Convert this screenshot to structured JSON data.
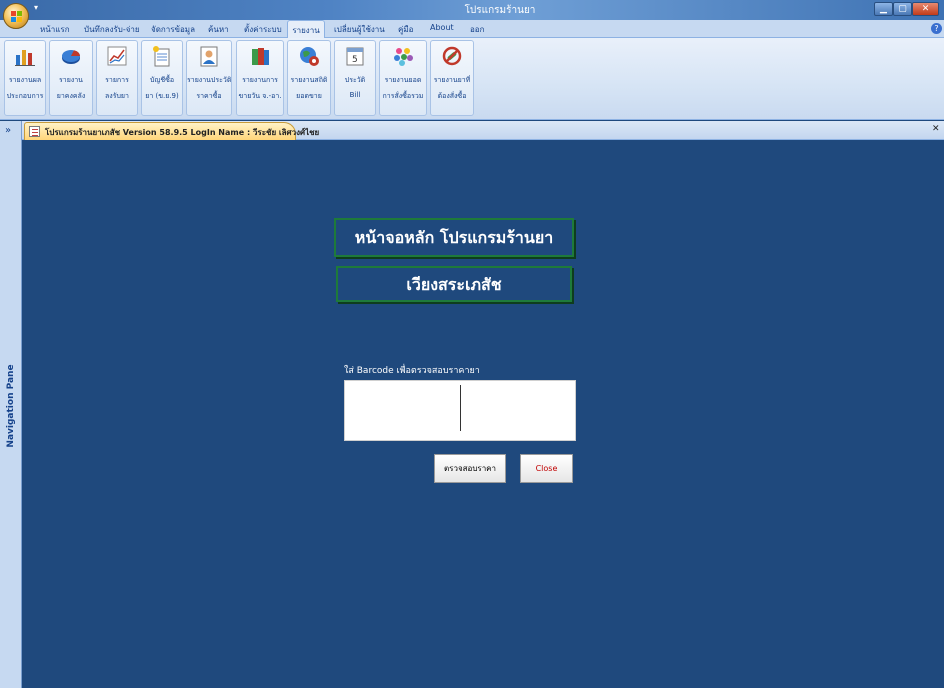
{
  "window": {
    "title": "โปรแกรมร้านยา"
  },
  "ribbon_tabs": [
    {
      "label": "หน้าแรก"
    },
    {
      "label": "บันทึกลงรับ-จ่าย"
    },
    {
      "label": "จัดการข้อมูล"
    },
    {
      "label": "ค้นหา"
    },
    {
      "label": "ตั้งค่าระบบ"
    },
    {
      "label": "รายงาน"
    },
    {
      "label": "เปลี่ยนผู้ใช้งาน"
    },
    {
      "label": "คู่มือ"
    },
    {
      "label": "About"
    },
    {
      "label": "ออก"
    }
  ],
  "active_tab": "รายงาน",
  "ribbon_buttons": [
    {
      "line1": "รายงานผล",
      "line2": "ประกอบการ",
      "icon": "bar-chart-icon"
    },
    {
      "line1": "รายงาน",
      "line2": "ยาคงคลัง",
      "icon": "pie-chart-icon"
    },
    {
      "line1": "รายการ",
      "line2": "ลงรับยา",
      "icon": "line-chart-icon"
    },
    {
      "line1": "บัญชีซื้อ",
      "line2": "ยา (ข.ย.9)",
      "icon": "ledger-icon"
    },
    {
      "line1": "รายงานประวัติ",
      "line2": "ราคาซื้อ",
      "icon": "user-report-icon"
    },
    {
      "line1": "รายงานการ",
      "line2": "ขายวัน จ.-อา.",
      "icon": "books-icon"
    },
    {
      "line1": "รายงานสถิติ",
      "line2": "ยอดขาย",
      "icon": "globe-stats-icon"
    },
    {
      "line1": "ประวัติ",
      "line2": "Bill",
      "icon": "calendar-icon"
    },
    {
      "line1": "รายงานยอด",
      "line2": "การสั่งซื้อรวม",
      "icon": "dots-icon"
    },
    {
      "line1": "รายงานยาที่",
      "line2": "ต้องสั่งซื้อ",
      "icon": "no-pill-icon"
    }
  ],
  "nav_pane": {
    "label": "Navigation Pane"
  },
  "document_tab": {
    "title": "โปรแกรมร้านยาเภสัช Version  58.9.5  LogIn Name :  วีระชัย   เลิศวงศ์ไชย"
  },
  "form": {
    "title_line1": "หน้าจอหลัก โปรแกรมร้านยา",
    "title_line2": "เวียงสระเภสัช",
    "barcode_label": "ใส่   Barcode เพื่อตรวจสอบราคายา",
    "barcode_value": "",
    "check_button": "ตรวจสอบราคา",
    "close_button": "Close"
  },
  "colors": {
    "form_bg": "#1f497d",
    "header_border": "#1e7a3a",
    "close_text": "#c00000"
  }
}
